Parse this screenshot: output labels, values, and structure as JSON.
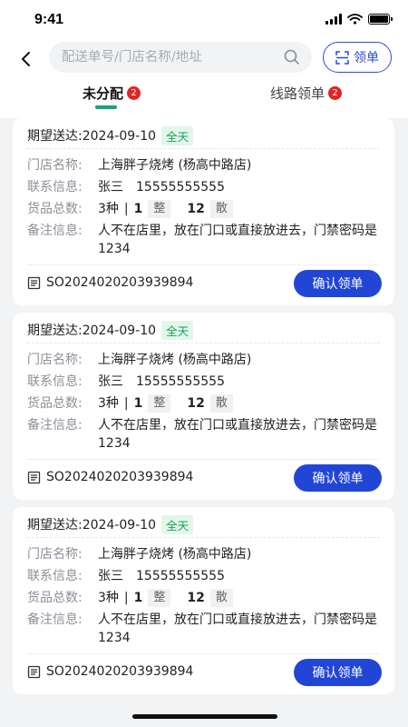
{
  "status_bar": {
    "time": "9:41"
  },
  "nav": {
    "search_placeholder": "配送单号/门店名称/地址",
    "claim_label": "领单"
  },
  "tabs": [
    {
      "label": "未分配",
      "badge": "2",
      "active": true
    },
    {
      "label": "线路领单",
      "badge": "2",
      "active": false
    }
  ],
  "labels": {
    "store": "门店名称:",
    "contact": "联系信息:",
    "goods": "货品总数:",
    "note": "备注信息:",
    "confirm": "确认领单"
  },
  "orders": [
    {
      "expect": "期望送达:2024-09-10",
      "tag": "全天",
      "store_name": "上海胖子烧烤 (杨高中路店)",
      "contact_name": "张三",
      "contact_phone": "15555555555",
      "kinds": "3种",
      "sep": "|",
      "whole_qty": "1",
      "whole_unit": "整",
      "loose_qty": "12",
      "loose_unit": "散",
      "note": "人不在店里，放在门口或直接放进去，门禁密码是1234",
      "order_no": "SO2024020203939894"
    },
    {
      "expect": "期望送达:2024-09-10",
      "tag": "全天",
      "store_name": "上海胖子烧烤 (杨高中路店)",
      "contact_name": "张三",
      "contact_phone": "15555555555",
      "kinds": "3种",
      "sep": "|",
      "whole_qty": "1",
      "whole_unit": "整",
      "loose_qty": "12",
      "loose_unit": "散",
      "note": "人不在店里，放在门口或直接放进去，门禁密码是1234",
      "order_no": "SO2024020203939894"
    },
    {
      "expect": "期望送达:2024-09-10",
      "tag": "全天",
      "store_name": "上海胖子烧烤 (杨高中路店)",
      "contact_name": "张三",
      "contact_phone": "15555555555",
      "kinds": "3种",
      "sep": "|",
      "whole_qty": "1",
      "whole_unit": "整",
      "loose_qty": "12",
      "loose_unit": "散",
      "note": "人不在店里，放在门口或直接放进去，门禁密码是1234",
      "order_no": "SO2024020203939894"
    }
  ],
  "colors": {
    "accent": "#2146d6",
    "tab_indicator": "#1aa37a",
    "badge": "#e02424",
    "tag_bg": "#e3f6ea",
    "tag_text": "#19a05b"
  },
  "icons": {
    "back": "chevron-left-icon",
    "search": "search-icon",
    "scan": "scan-icon",
    "order": "document-icon"
  }
}
